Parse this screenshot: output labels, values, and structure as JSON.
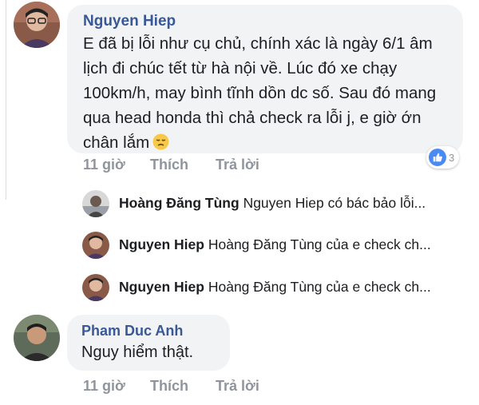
{
  "comment_main": {
    "author": "Nguyen Hiep",
    "text": "E đã bị lỗi như cụ chủ, chính xác là ngày 6/1 âm lịch đi chúc tết từ hà nội về. Lúc đó xe chạy 100km/h, may bình tĩnh dồn dc số. Sau đó mang qua head honda thì chả check ra lỗi j, e giờ ớn chân lắm",
    "emoji": "disappointed-face",
    "time": "11 giờ",
    "like_label": "Thích",
    "reply_label": "Trả lời",
    "reaction_count": "3"
  },
  "replies": [
    {
      "author": "Hoàng Đăng Tùng",
      "preview": "Nguyen Hiep có bác bảo lỗi..."
    },
    {
      "author": "Nguyen Hiep",
      "preview": "Hoàng Đăng Tùng của e check ch..."
    },
    {
      "author": "Nguyen Hiep",
      "preview": "Hoàng Đăng Tùng của e check ch..."
    }
  ],
  "comment_second": {
    "author": "Pham Duc Anh",
    "text": "Nguy hiểm thật.",
    "time": "11 giờ",
    "like_label": "Thích",
    "reply_label": "Trả lời"
  },
  "colors": {
    "author_link": "#385898",
    "bubble_bg": "#f2f3f5",
    "action_gray": "#90949c",
    "like_blue": "#4a8af4"
  }
}
